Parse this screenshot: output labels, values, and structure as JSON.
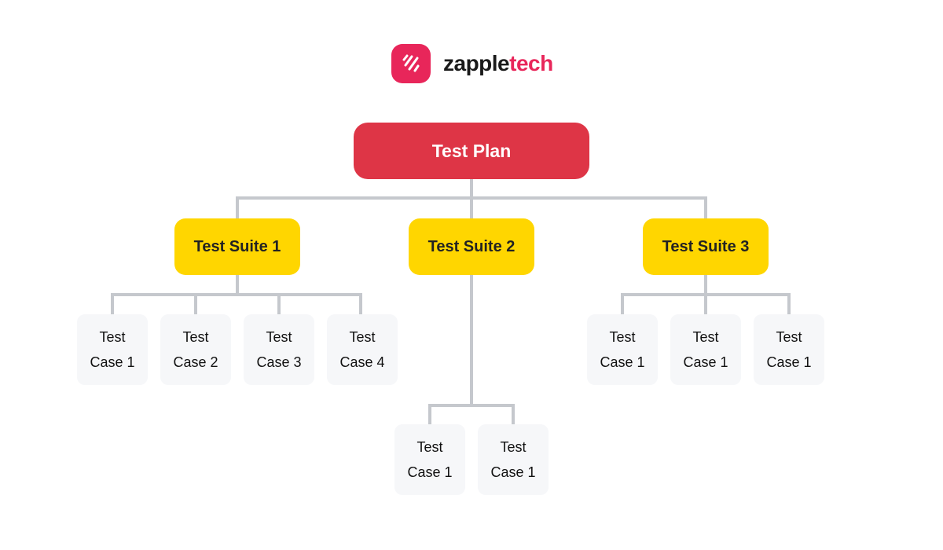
{
  "logo": {
    "name_primary": "zapple",
    "name_accent": "tech",
    "icon": "zappletech-logo-icon",
    "brand_color": "#e8265a"
  },
  "colors": {
    "plan": "#de3546",
    "suite": "#ffd600",
    "case": "#f6f7f9",
    "connector": "#c5c8cd"
  },
  "plan": {
    "label": "Test Plan"
  },
  "suites": [
    {
      "label": "Test Suite 1",
      "cases": [
        "Test Case 1",
        "Test Case 2",
        "Test Case 3",
        "Test Case 4"
      ]
    },
    {
      "label": "Test Suite 2",
      "cases": [
        "Test Case 1",
        "Test Case 1"
      ]
    },
    {
      "label": "Test Suite 3",
      "cases": [
        "Test Case 1",
        "Test Case 1",
        "Test Case 1"
      ]
    }
  ]
}
